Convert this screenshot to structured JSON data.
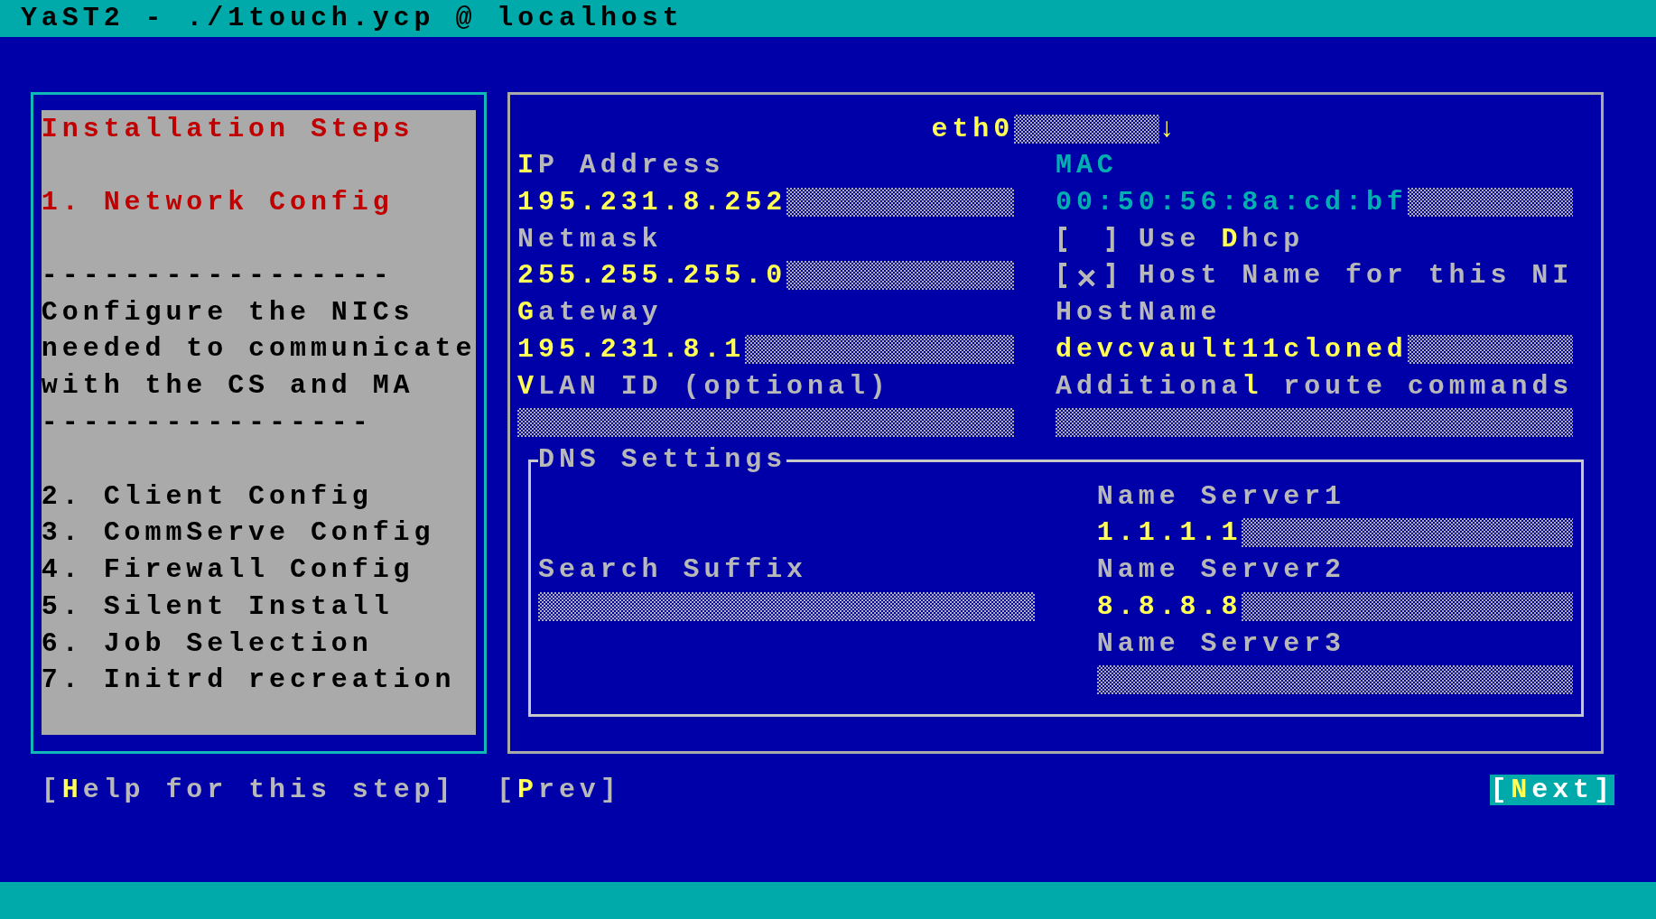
{
  "window": {
    "title": "YaST2 - ./1touch.ycp @ localhost"
  },
  "steps_panel": {
    "heading": "Installation Steps",
    "separator_top": "-----------------",
    "description": "Configure the NICs\nneeded to communicate\nwith the CS and MA",
    "separator_bottom": "----------------",
    "steps": [
      {
        "label": "1. Network Config",
        "current": true
      },
      {
        "label": "2. Client Config",
        "current": false
      },
      {
        "label": "3. CommServe Config",
        "current": false
      },
      {
        "label": "4. Firewall Config",
        "current": false
      },
      {
        "label": "5. Silent Install",
        "current": false
      },
      {
        "label": "6. Job Selection",
        "current": false
      },
      {
        "label": "7. Initrd recreation",
        "current": false
      }
    ]
  },
  "interface": {
    "value": "eth0",
    "arrow": "↓"
  },
  "left_fields": [
    {
      "label": "**I**P Address",
      "value": "195.231.8.252"
    },
    {
      "label": "Netmask",
      "value": "255.255.255.0"
    },
    {
      "label": "**G**ateway",
      "value": "195.231.8.1"
    },
    {
      "label": "**V**LAN ID (optional)"
    }
  ],
  "right_items": [
    {
      "kind": "field",
      "label": "MAC",
      "value": "00:50:56:8a:cd:bf",
      "disabled": true
    },
    {
      "kind": "checkbox",
      "label": "Use **D**hcp",
      "checked": false
    },
    {
      "kind": "checkbox",
      "label": "Host Name for this NI",
      "checked": true
    },
    {
      "kind": "field",
      "label": "HostName",
      "value": "devcvault11cloned",
      "disabled": false
    },
    {
      "kind": "field",
      "label": "Additiona**l** route commands",
      "disabled": false
    }
  ],
  "dns": {
    "title": "DNS Settings",
    "search_suffix": {
      "label": "Search Suffix"
    },
    "name_servers": [
      {
        "label": "Name Server1",
        "value": "1.1.1.1"
      },
      {
        "label": "Name Server2",
        "value": "8.8.8.8"
      },
      {
        "label": "Name Server3"
      }
    ]
  },
  "buttons": [
    {
      "label": "[**H**elp for this step]",
      "default": false
    },
    {
      "label": "[**P**rev]",
      "default": false
    },
    {
      "label": "[**N**ext]",
      "default": true
    }
  ]
}
